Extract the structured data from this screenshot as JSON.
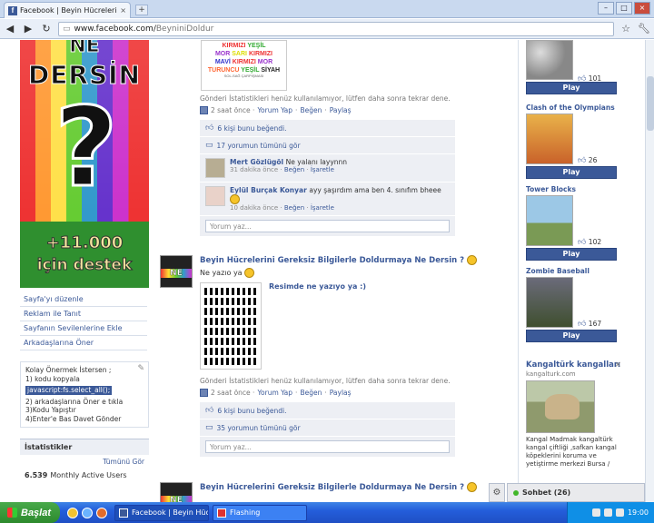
{
  "browser": {
    "tab_title": "Facebook | Beyin Hücreleri...",
    "tab_close": "×",
    "new_tab": "+",
    "url_host": "www.facebook.com/",
    "url_path": "BeyniniDoldur",
    "window_buttons": [
      "–",
      "□",
      "×"
    ]
  },
  "left": {
    "poster": {
      "ne": "NE",
      "dersin": "DERSİN",
      "q": "?",
      "count": "+11.000",
      "destek": "için destek"
    },
    "links": [
      "Sayfa'yı düzenle",
      "Reklam ile Tanıt",
      "Sayfanın Sevilenlerine Ekle",
      "Arkadaşlarına Öner"
    ],
    "note": {
      "line1": "Kolay Önermek İstersen ;",
      "line2": "1) kodu kopyala",
      "code": "javascript:fs.select_all();",
      "line3": "2) arkadaşlarına Öner e tıkla",
      "line4": "3)Kodu Yapıştır",
      "line5": "4)Enter'e Bas Davet Gönder"
    },
    "stats": {
      "heading": "İstatistikler",
      "see_all": "Tümünü Gör",
      "value": "6.539",
      "label": "Monthly Active Users"
    }
  },
  "feed": {
    "color_image": {
      "rows": [
        {
          "t": "KIRMIZI YEŞİL",
          "c": "#e33"
        },
        {
          "t": "MOR  SARI  KIRMIZI",
          "c": "#93c"
        },
        {
          "t": "MAVİ KIRMIZI  MOR",
          "c": "#33c"
        },
        {
          "t": "TURUNCU YEŞİL SİYAH",
          "c": "#f63"
        }
      ],
      "footer": "SOL-SAĞ ÇARPIŞMASI"
    },
    "post1_status": "Gönderi İstatistikleri henüz kullanılamıyor, lütfen daha sonra tekrar dene.",
    "post1_time": "2 saat önce · ",
    "comment_action": "Yorum Yap",
    "like_action": "Beğen",
    "share_action": "Paylaş",
    "post1_likes": "6 kişi bunu beğendi.",
    "post1_comments_all": "17 yorumun tümünü gör",
    "comments": [
      {
        "name": "Mert Gözlügöl",
        "text": "Ne yalanı layynnn",
        "meta": "31 dakika önce · ",
        "like": "Beğen",
        "flag": "İşaretle"
      },
      {
        "name": "Eylül Burçak Konyar",
        "text": "ayy şaşırdım ama ben 4. sınıfım bheee",
        "meta": "10 dakika önce · ",
        "like": "Beğen",
        "flag": "İşaretle"
      }
    ],
    "comment_placeholder": "Yorum yaz...",
    "post2": {
      "avatar_text": "NE",
      "title": "Beyin Hücrelerini Gereksiz Bilgilerle Doldurmaya Ne Dersin ?",
      "sub": "Ne yazıo ya",
      "attach_title": "Resimde ne yazıyo ya :)",
      "status": "Gönderi İstatistikleri henüz kullanılamıyor, lütfen daha sonra tekrar dene.",
      "time": "2 saat önce · ",
      "likes": "6 kişi bunu beğendi.",
      "comments_all": "35 yorumun tümünü gör",
      "placeholder": "Yorum yaz..."
    },
    "post3": {
      "title": "Beyin Hücrelerini Gereksiz Bilgilerle Doldurmaya Ne Dersin ?"
    }
  },
  "right": {
    "games": [
      {
        "name": "",
        "likes": "101",
        "play": "Play"
      },
      {
        "name": "Clash of the Olympians",
        "likes": "26",
        "play": "Play"
      },
      {
        "name": "Tower Blocks",
        "likes": "102",
        "play": "Play"
      },
      {
        "name": "Zombie Baseball",
        "likes": "167",
        "play": "Play"
      }
    ],
    "ad": {
      "title": "Kangaltürk kangalları",
      "close": "×",
      "domain": "kangalturk.com",
      "text": "Kangal Madmak kangaltürk kangal çiftliği ,safkan kangal köpeklerini koruma ve yetiştirme merkezi Bursa /"
    }
  },
  "chat": {
    "label": "Sohbet (26)",
    "options_icon": "⚙"
  },
  "taskbar": {
    "start": "Başlat",
    "tasks": [
      "Facebook | Beyin Hüc...",
      "Flashing"
    ],
    "clock": "19:00"
  },
  "colors": {
    "facebook_blue": "#3b5998",
    "link": "#3b5998",
    "ufi_bg": "#edeff4"
  }
}
